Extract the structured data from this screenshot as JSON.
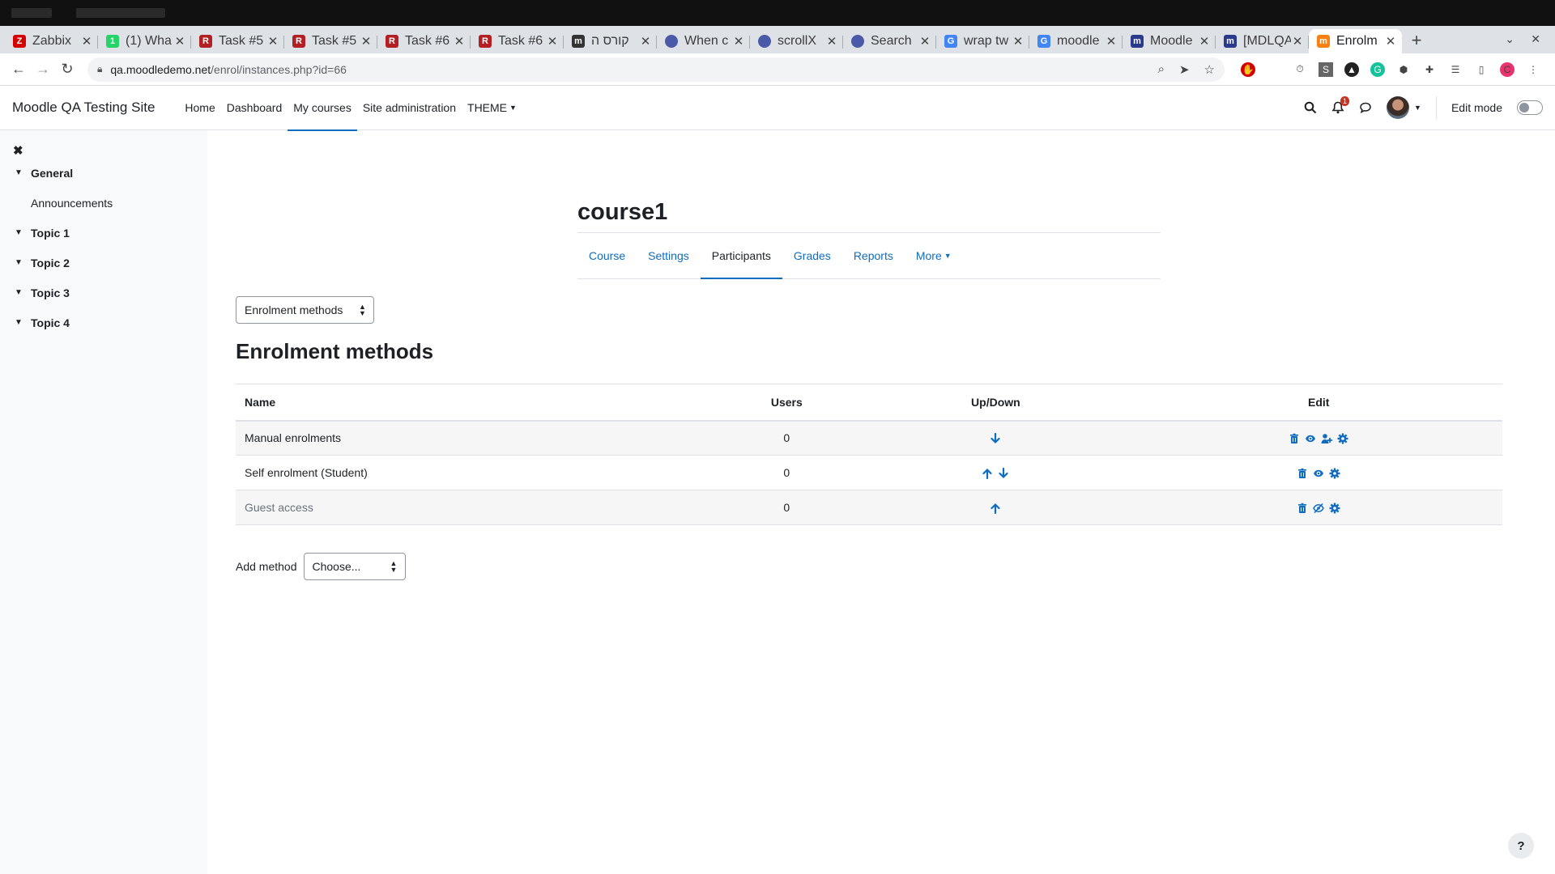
{
  "browser": {
    "tabs": [
      {
        "title": "Zabbix",
        "favicon": "zabbix-icon",
        "color": "#d40000",
        "letter": "Z"
      },
      {
        "title": "(1) Wha",
        "favicon": "whatsapp-icon",
        "color": "#25d366",
        "letter": "1"
      },
      {
        "title": "Task #5",
        "favicon": "redmine-icon",
        "color": "#b32024",
        "letter": "R"
      },
      {
        "title": "Task #5",
        "favicon": "redmine-icon",
        "color": "#b32024",
        "letter": "R"
      },
      {
        "title": "Task #6",
        "favicon": "redmine-icon",
        "color": "#b32024",
        "letter": "R"
      },
      {
        "title": "Task #6",
        "favicon": "redmine-icon",
        "color": "#b32024",
        "letter": "R"
      },
      {
        "title": "קורס ה",
        "favicon": "moodle-icon",
        "color": "#333333",
        "letter": "m"
      },
      {
        "title": "When c",
        "favicon": "globe-icon",
        "color": "#4b5aa8",
        "letter": ""
      },
      {
        "title": "scrollX",
        "favicon": "globe-icon",
        "color": "#4b5aa8",
        "letter": ""
      },
      {
        "title": "Search",
        "favicon": "globe-icon",
        "color": "#4b5aa8",
        "letter": ""
      },
      {
        "title": "wrap tw",
        "favicon": "google-icon",
        "color": "#4285f4",
        "letter": "G"
      },
      {
        "title": "moodle",
        "favicon": "google-icon",
        "color": "#4285f4",
        "letter": "G"
      },
      {
        "title": "Moodle",
        "favicon": "jira-icon",
        "color": "#2b3a8c",
        "letter": "m"
      },
      {
        "title": "[MDLQA",
        "favicon": "jira-icon",
        "color": "#2b3a8c",
        "letter": "m"
      },
      {
        "title": "Enrolm",
        "favicon": "moodle-icon",
        "color": "#f98012",
        "letter": "m"
      }
    ],
    "url_domain": "qa.moodledemo.net",
    "url_path": "/enrol/instances.php?id=66",
    "profile_letter": "C"
  },
  "navbar": {
    "brand": "Moodle QA Testing Site",
    "links": [
      "Home",
      "Dashboard",
      "My courses",
      "Site administration",
      "THEME"
    ],
    "notification_count": "1",
    "edit_mode_label": "Edit mode"
  },
  "drawer": {
    "sections": [
      {
        "label": "General",
        "children": [
          "Announcements"
        ]
      },
      {
        "label": "Topic 1",
        "children": []
      },
      {
        "label": "Topic 2",
        "children": []
      },
      {
        "label": "Topic 3",
        "children": []
      },
      {
        "label": "Topic 4",
        "children": []
      }
    ]
  },
  "course": {
    "title": "course1",
    "tabs": [
      "Course",
      "Settings",
      "Participants",
      "Grades",
      "Reports",
      "More"
    ],
    "active_tab": "Participants"
  },
  "page": {
    "selector_value": "Enrolment methods",
    "heading": "Enrolment methods",
    "table": {
      "headers": [
        "Name",
        "Users",
        "Up/Down",
        "Edit"
      ],
      "rows": [
        {
          "name": "Manual enrolments",
          "users": "0",
          "updown": [
            "down"
          ],
          "edit": [
            "delete",
            "visible",
            "enrol-users",
            "settings"
          ],
          "dimmed": false
        },
        {
          "name": "Self enrolment (Student)",
          "users": "0",
          "updown": [
            "up",
            "down"
          ],
          "edit": [
            "delete",
            "visible",
            "settings"
          ],
          "dimmed": false
        },
        {
          "name": "Guest access",
          "users": "0",
          "updown": [
            "up"
          ],
          "edit": [
            "delete",
            "hidden",
            "settings"
          ],
          "dimmed": true
        }
      ]
    },
    "add_method_label": "Add method",
    "add_method_value": "Choose..."
  },
  "colors": {
    "link": "#0f6cbf",
    "accent": "#0f6cbf"
  }
}
